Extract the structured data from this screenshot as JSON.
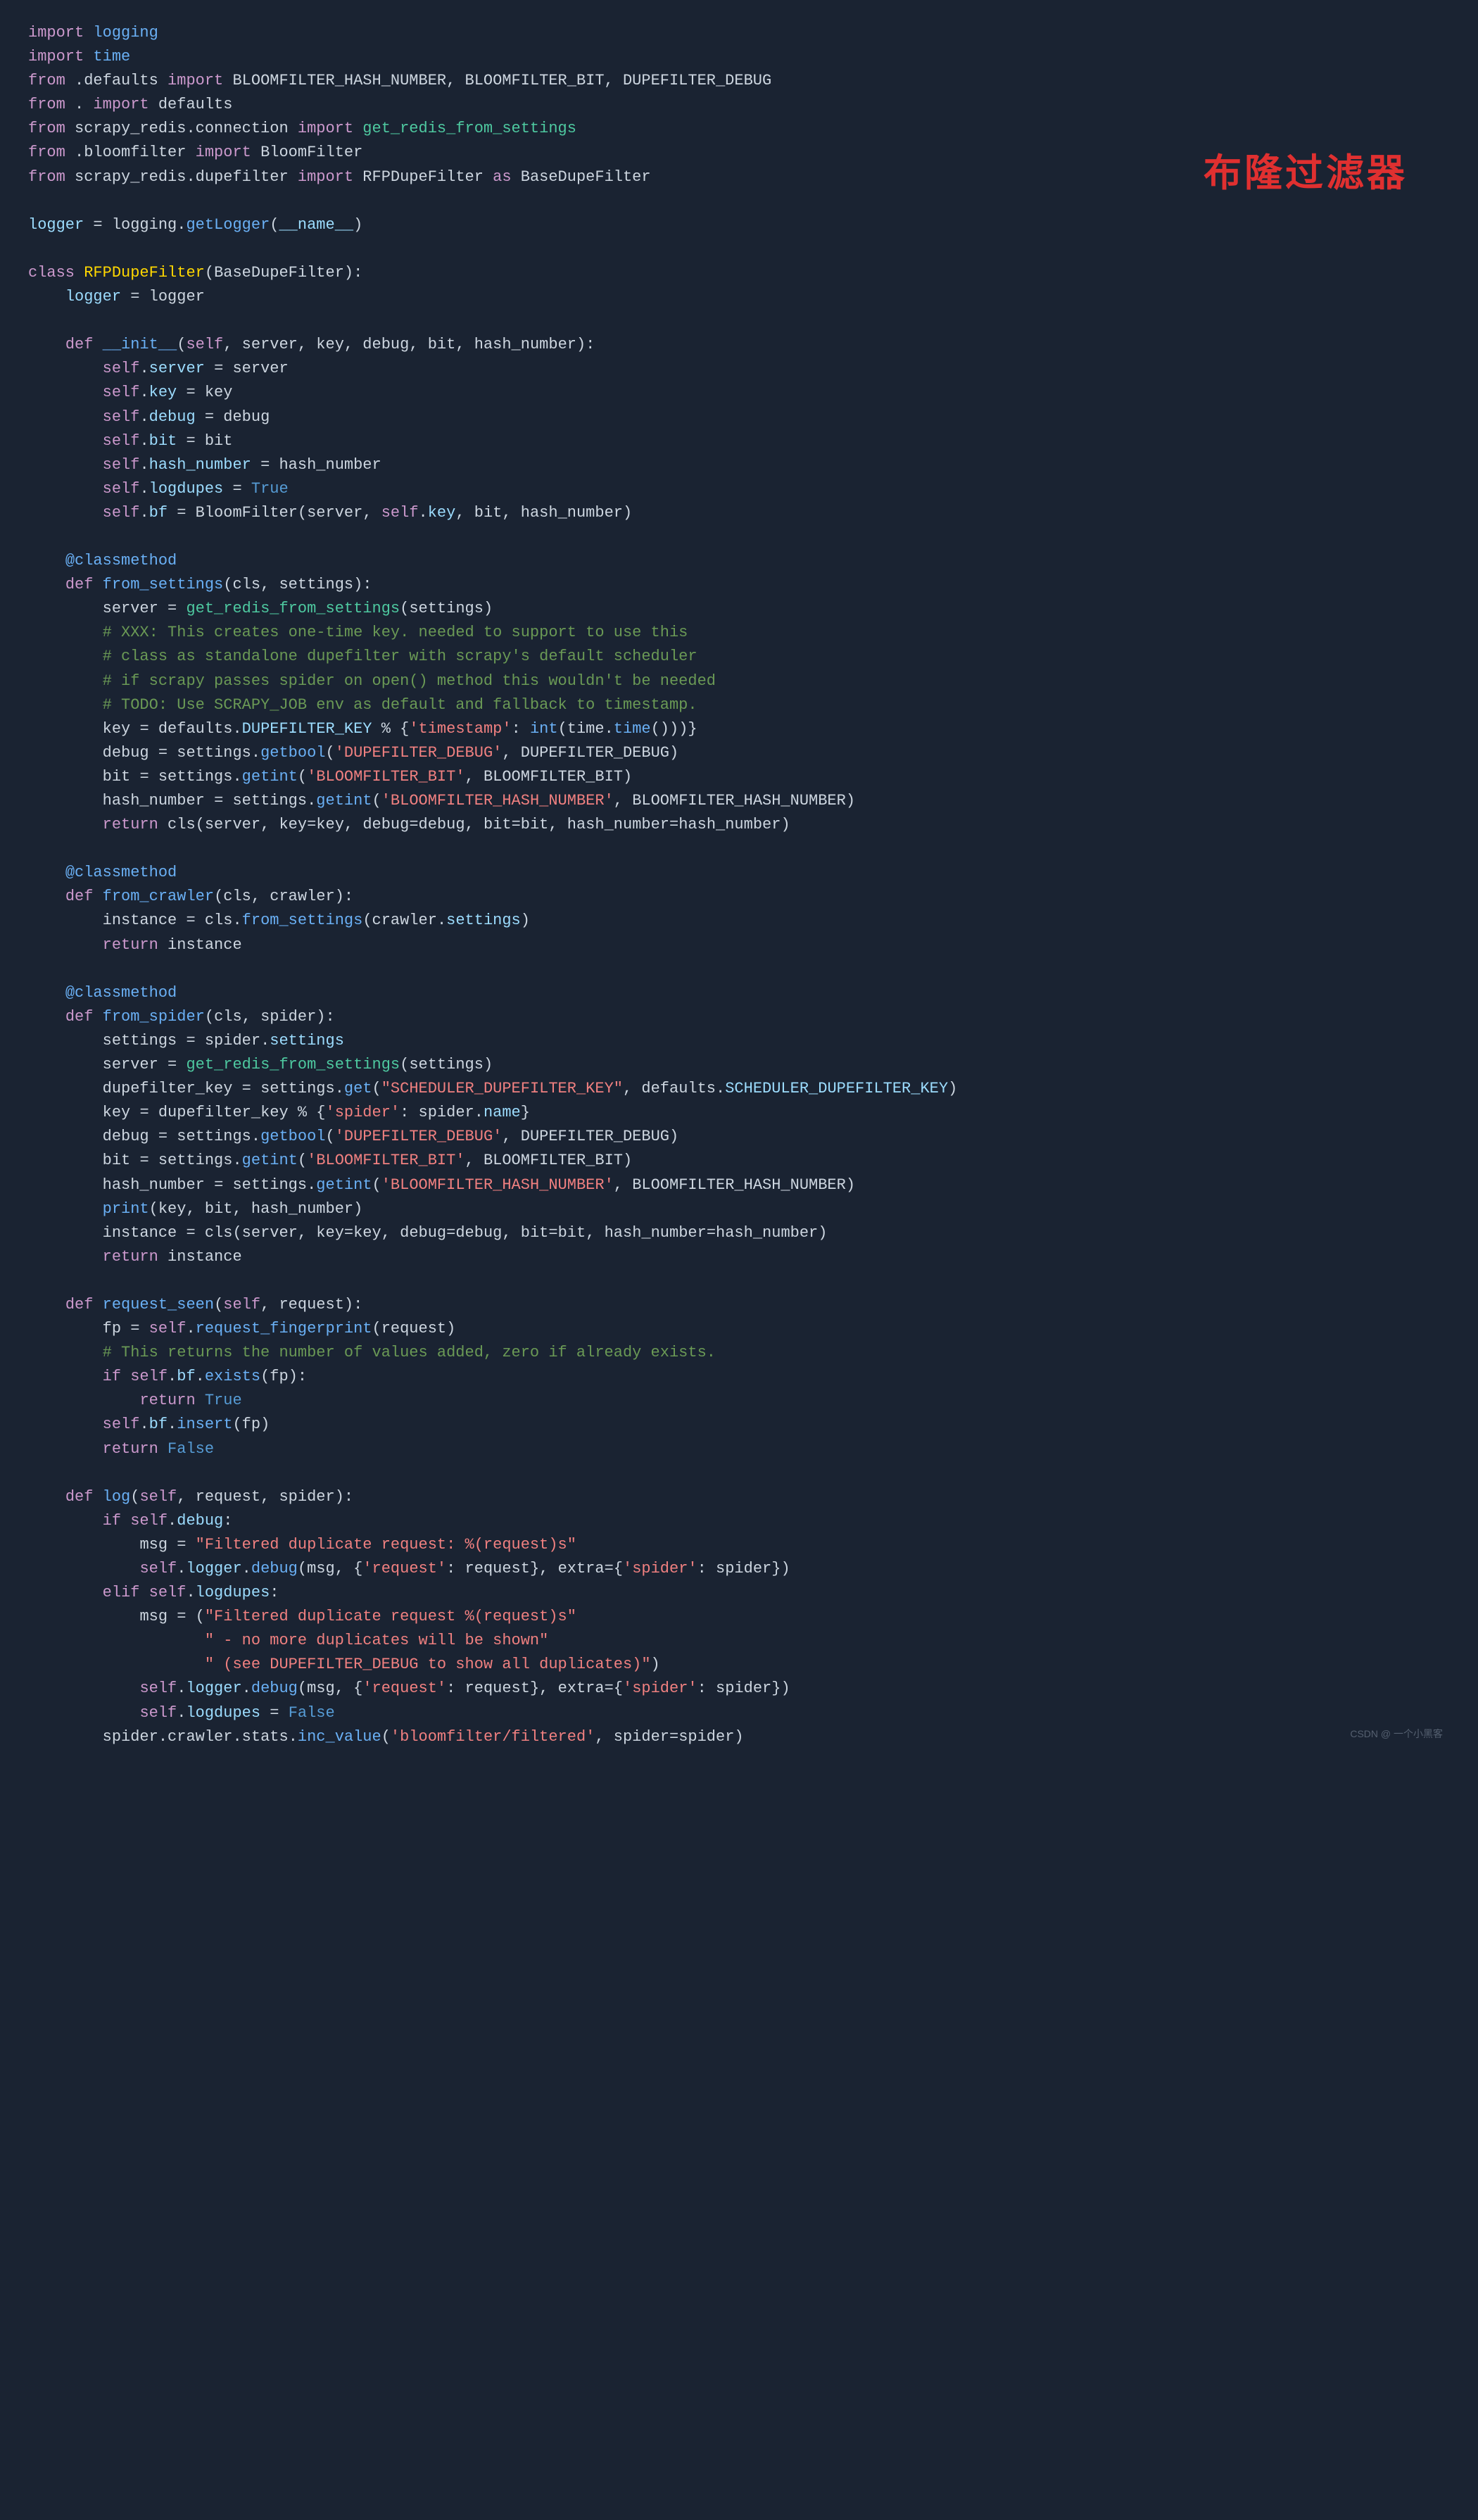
{
  "title": "布隆过滤器",
  "watermark": "CSDN @ 一个小黑客",
  "code": {
    "lines": [
      {
        "id": 1,
        "text": "import logging"
      },
      {
        "id": 2,
        "text": "import time"
      },
      {
        "id": 3,
        "text": "from .defaults import BLOOMFILTER_HASH_NUMBER, BLOOMFILTER_BIT, DUPEFILTER_DEBUG"
      },
      {
        "id": 4,
        "text": "from . import defaults"
      },
      {
        "id": 5,
        "text": "from scrapy_redis.connection import get_redis_from_settings"
      },
      {
        "id": 6,
        "text": "from .bloomfilter import BloomFilter"
      },
      {
        "id": 7,
        "text": "from scrapy_redis.dupefilter import RFPDupeFilter as BaseDupeFilter"
      },
      {
        "id": 8,
        "blank": true
      },
      {
        "id": 9,
        "text": "logger = logging.getLogger(__name__)"
      },
      {
        "id": 10,
        "blank": true
      },
      {
        "id": 11,
        "text": "class RFPDupeFilter(BaseDupeFilter):"
      },
      {
        "id": 12,
        "text": "    logger = logger",
        "indent": 1
      },
      {
        "id": 13,
        "blank": true
      },
      {
        "id": 14,
        "text": "    def __init__(self, server, key, debug, bit, hash_number):",
        "indent": 1
      },
      {
        "id": 15,
        "text": "        self.server = server",
        "indent": 2
      },
      {
        "id": 16,
        "text": "        self.key = key",
        "indent": 2
      },
      {
        "id": 17,
        "text": "        self.debug = debug",
        "indent": 2
      },
      {
        "id": 18,
        "text": "        self.bit = bit",
        "indent": 2
      },
      {
        "id": 19,
        "text": "        self.hash_number = hash_number",
        "indent": 2
      },
      {
        "id": 20,
        "text": "        self.logdupes = True",
        "indent": 2
      },
      {
        "id": 21,
        "text": "        self.bf = BloomFilter(server, self.key, bit, hash_number)",
        "indent": 2
      },
      {
        "id": 22,
        "blank": true
      },
      {
        "id": 23,
        "text": "    @classmethod",
        "indent": 1
      },
      {
        "id": 24,
        "text": "    def from_settings(cls, settings):",
        "indent": 1
      },
      {
        "id": 25,
        "text": "        server = get_redis_from_settings(settings)",
        "indent": 2
      },
      {
        "id": 26,
        "text": "        # XXX: This creates one-time key. needed to support to use this",
        "indent": 2
      },
      {
        "id": 27,
        "text": "        # class as standalone dupefilter with scrapy's default scheduler",
        "indent": 2
      },
      {
        "id": 28,
        "text": "        # if scrapy passes spider on open() method this wouldn't be needed",
        "indent": 2
      },
      {
        "id": 29,
        "text": "        # TODO: Use SCRAPY_JOB env as default and fallback to timestamp.",
        "indent": 2
      },
      {
        "id": 30,
        "text": "        key = defaults.DUPEFILTER_KEY % {'timestamp': int(time.time())}",
        "indent": 2
      },
      {
        "id": 31,
        "text": "        debug = settings.getbool('DUPEFILTER_DEBUG', DUPEFILTER_DEBUG)",
        "indent": 2
      },
      {
        "id": 32,
        "text": "        bit = settings.getint('BLOOMFILTER_BIT', BLOOMFILTER_BIT)",
        "indent": 2
      },
      {
        "id": 33,
        "text": "        hash_number = settings.getint('BLOOMFILTER_HASH_NUMBER', BLOOMFILTER_HASH_NUMBER)",
        "indent": 2
      },
      {
        "id": 34,
        "text": "        return cls(server, key=key, debug=debug, bit=bit, hash_number=hash_number)",
        "indent": 2
      },
      {
        "id": 35,
        "blank": true
      },
      {
        "id": 36,
        "text": "    @classmethod",
        "indent": 1
      },
      {
        "id": 37,
        "text": "    def from_crawler(cls, crawler):",
        "indent": 1
      },
      {
        "id": 38,
        "text": "        instance = cls.from_settings(crawler.settings)",
        "indent": 2
      },
      {
        "id": 39,
        "text": "        return instance",
        "indent": 2
      },
      {
        "id": 40,
        "blank": true
      },
      {
        "id": 41,
        "text": "    @classmethod",
        "indent": 1
      },
      {
        "id": 42,
        "text": "    def from_spider(cls, spider):",
        "indent": 1
      },
      {
        "id": 43,
        "text": "        settings = spider.settings",
        "indent": 2
      },
      {
        "id": 44,
        "text": "        server = get_redis_from_settings(settings)",
        "indent": 2
      },
      {
        "id": 45,
        "text": "        dupefilter_key = settings.get(\"SCHEDULER_DUPEFILTER_KEY\", defaults.SCHEDULER_DUPEFILTER_KEY)",
        "indent": 2
      },
      {
        "id": 46,
        "text": "        key = dupefilter_key % {'spider': spider.name}",
        "indent": 2
      },
      {
        "id": 47,
        "text": "        debug = settings.getbool('DUPEFILTER_DEBUG', DUPEFILTER_DEBUG)",
        "indent": 2
      },
      {
        "id": 48,
        "text": "        bit = settings.getint('BLOOMFILTER_BIT', BLOOMFILTER_BIT)",
        "indent": 2
      },
      {
        "id": 49,
        "text": "        hash_number = settings.getint('BLOOMFILTER_HASH_NUMBER', BLOOMFILTER_HASH_NUMBER)",
        "indent": 2
      },
      {
        "id": 50,
        "text": "        print(key, bit, hash_number)",
        "indent": 2
      },
      {
        "id": 51,
        "text": "        instance = cls(server, key=key, debug=debug, bit=bit, hash_number=hash_number)",
        "indent": 2
      },
      {
        "id": 52,
        "text": "        return instance",
        "indent": 2
      },
      {
        "id": 53,
        "blank": true
      },
      {
        "id": 54,
        "text": "    def request_seen(self, request):",
        "indent": 1
      },
      {
        "id": 55,
        "text": "        fp = self.request_fingerprint(request)",
        "indent": 2
      },
      {
        "id": 56,
        "text": "        # This returns the number of values added, zero if already exists.",
        "indent": 2
      },
      {
        "id": 57,
        "text": "        if self.bf.exists(fp):",
        "indent": 2
      },
      {
        "id": 58,
        "text": "            return True",
        "indent": 3
      },
      {
        "id": 59,
        "text": "        self.bf.insert(fp)",
        "indent": 2
      },
      {
        "id": 60,
        "text": "        return False",
        "indent": 2
      },
      {
        "id": 61,
        "blank": true
      },
      {
        "id": 62,
        "text": "    def log(self, request, spider):",
        "indent": 1
      },
      {
        "id": 63,
        "text": "        if self.debug:",
        "indent": 2
      },
      {
        "id": 64,
        "text": "            msg = \"Filtered duplicate request: %(request)s\"",
        "indent": 3
      },
      {
        "id": 65,
        "text": "            self.logger.debug(msg, {'request': request}, extra={'spider': spider})",
        "indent": 3
      },
      {
        "id": 66,
        "text": "        elif self.logdupes:",
        "indent": 2
      },
      {
        "id": 67,
        "text": "            msg = (\"Filtered duplicate request %(request)s\"",
        "indent": 3
      },
      {
        "id": 68,
        "text": "                   \" - no more duplicates will be shown\"",
        "indent": 4
      },
      {
        "id": 69,
        "text": "                   \" (see DUPEFILTER_DEBUG to show all duplicates)\")",
        "indent": 4
      },
      {
        "id": 70,
        "text": "            self.logger.debug(msg, {'request': request}, extra={'spider': spider})",
        "indent": 3
      },
      {
        "id": 71,
        "text": "            self.logdupes = False",
        "indent": 3
      },
      {
        "id": 72,
        "text": "        spider.crawler.stats.inc_value('bloomfilter/filtered', spider=spider)",
        "indent": 2
      }
    ]
  }
}
